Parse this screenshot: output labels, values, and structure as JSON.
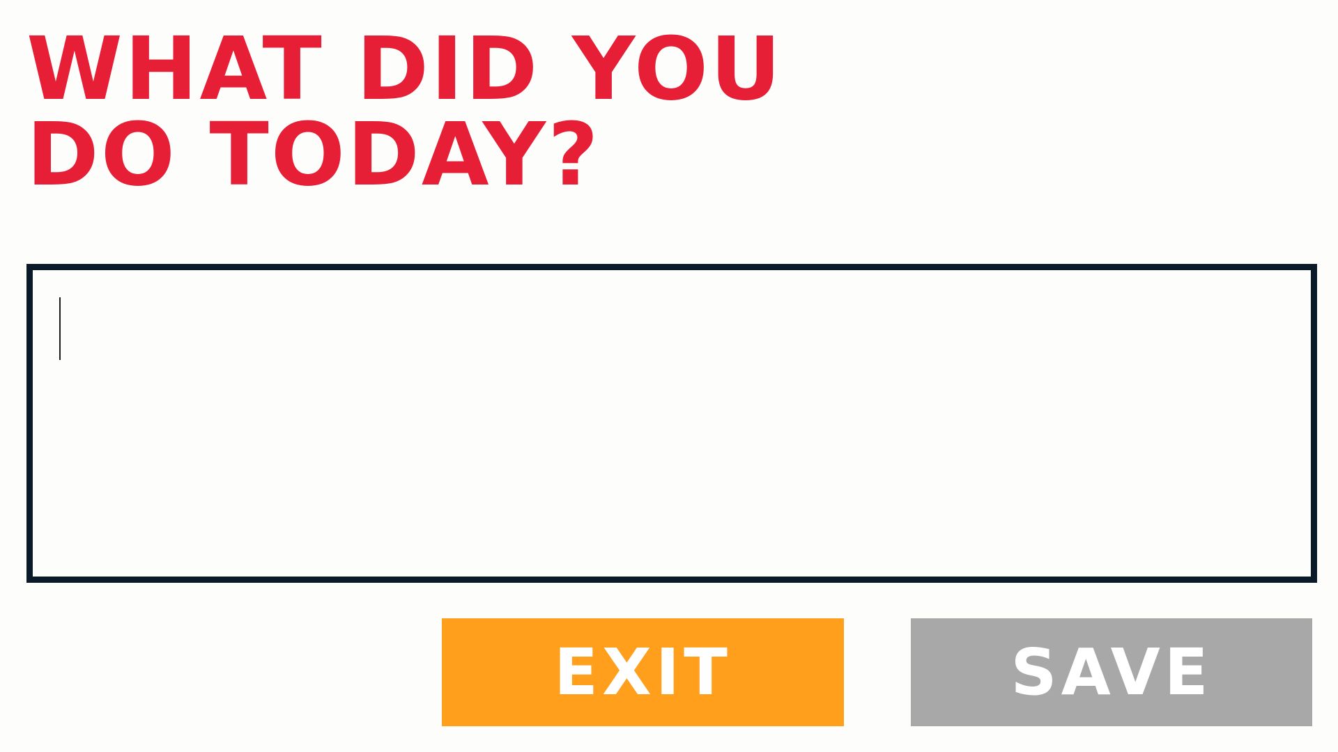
{
  "prompt": {
    "line1": "WHAT DID YOU",
    "line2": "DO TODAY?"
  },
  "entry": {
    "value": "",
    "placeholder": ""
  },
  "buttons": {
    "exit_label": "EXIT",
    "save_label": "SAVE"
  },
  "colors": {
    "heading": "#e61e36",
    "box_border": "#0b1a29",
    "exit_bg": "#ff9f1c",
    "save_bg": "#a8a8a8",
    "background": "#fdfdfb"
  },
  "icons": {
    "pointer": "mouse-pointer-icon"
  }
}
